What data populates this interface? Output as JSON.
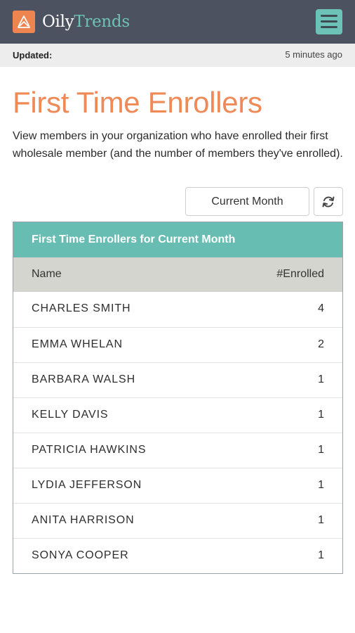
{
  "header": {
    "logo_icon": "oil-drop-logo-icon",
    "brand_part1": "Oily",
    "brand_part2": "Trends",
    "menu_icon": "hamburger-menu-icon",
    "colors": {
      "bar": "#4d5260",
      "logo": "#ee8450",
      "accent": "#6cc2b6"
    }
  },
  "status": {
    "updated_label": "Updated:",
    "updated_value": "5 minutes ago"
  },
  "main": {
    "title": "First Time Enrollers",
    "description": "View members in your organization who have enrolled their first wholesale member (and the number of members they've enrolled).",
    "period_select": "Current Month",
    "refresh_icon": "refresh-icon"
  },
  "table": {
    "heading": "First Time Enrollers for Current Month",
    "columns": [
      "Name",
      "#Enrolled"
    ],
    "rows": [
      {
        "name": "CHARLES SMITH",
        "count": "4"
      },
      {
        "name": "EMMA WHELAN",
        "count": "2"
      },
      {
        "name": "BARBARA WALSH",
        "count": "1"
      },
      {
        "name": "KELLY DAVIS",
        "count": "1"
      },
      {
        "name": "PATRICIA HAWKINS",
        "count": "1"
      },
      {
        "name": "LYDIA JEFFERSON",
        "count": "1"
      },
      {
        "name": "ANITA HARRISON",
        "count": "1"
      },
      {
        "name": "SONYA COOPER",
        "count": "1"
      }
    ],
    "colors": {
      "heading_bg": "#68bdb3",
      "column_bg": "#d5d5cf",
      "title": "#ef8a57"
    }
  }
}
